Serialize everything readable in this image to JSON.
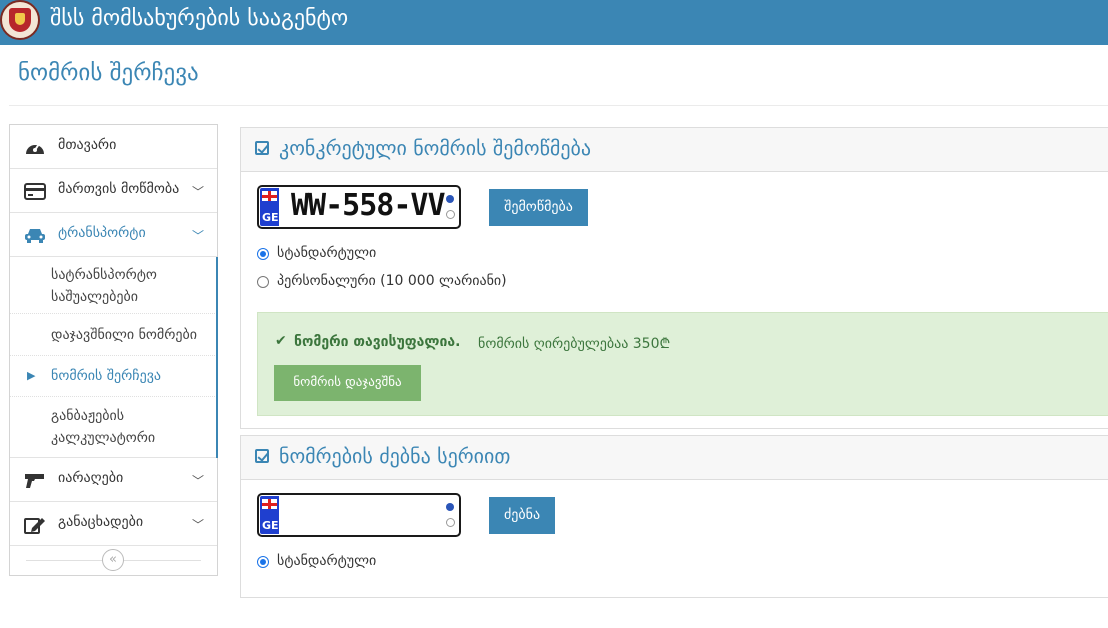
{
  "header": {
    "title": "შსს მომსახურების სააგენტო",
    "logo": "ministry-emblem"
  },
  "page": {
    "title": "ნომრის შერჩევა"
  },
  "sidebar": {
    "items": [
      {
        "label": "მთავარი",
        "icon": "dashboard-icon"
      },
      {
        "label": "მართვის მოწმობა",
        "icon": "card-icon"
      },
      {
        "label": "ტრანსპორტი",
        "icon": "car-icon"
      },
      {
        "label": "იარაღები",
        "icon": "gun-icon"
      },
      {
        "label": "განაცხადები",
        "icon": "edit-icon"
      }
    ],
    "subitems": [
      {
        "line1": "სატრანსპორტო",
        "line2": "საშუალებები"
      },
      {
        "line1": "დაჯავშნილი ნომრები"
      },
      {
        "line1": "ნომრის შერჩევა"
      },
      {
        "line1": "განბაჟების",
        "line2": "კალკულატორი"
      }
    ],
    "collapse_icon": "«"
  },
  "check_panel": {
    "title": "კონკრეტული ნომრის შემოწმება",
    "plate": {
      "country": "GE",
      "number": "WW-558-VV"
    },
    "check_button": "შემოწმება",
    "options": [
      {
        "label": "სტანდარტული",
        "checked": true
      },
      {
        "label": "პერსონალური (10 000 ლარიანი)",
        "checked": false
      }
    ],
    "alert": {
      "icon": "✔",
      "strong": "ნომერი თავისუფალია.",
      "text": "ნომრის ღირებულებაა 350₾",
      "button": "ნომრის დაჯავშნა"
    }
  },
  "search_panel": {
    "title": "ნომრების ძებნა სერიით",
    "plate": {
      "country": "GE",
      "number": ""
    },
    "search_button": "ძებნა",
    "options": [
      {
        "label": "სტანდარტული",
        "checked": true
      }
    ]
  },
  "colors": {
    "primary": "#3b86b4",
    "success_bg": "#dff0d8",
    "success_text": "#3c763d",
    "success_button": "#7cb46e"
  }
}
